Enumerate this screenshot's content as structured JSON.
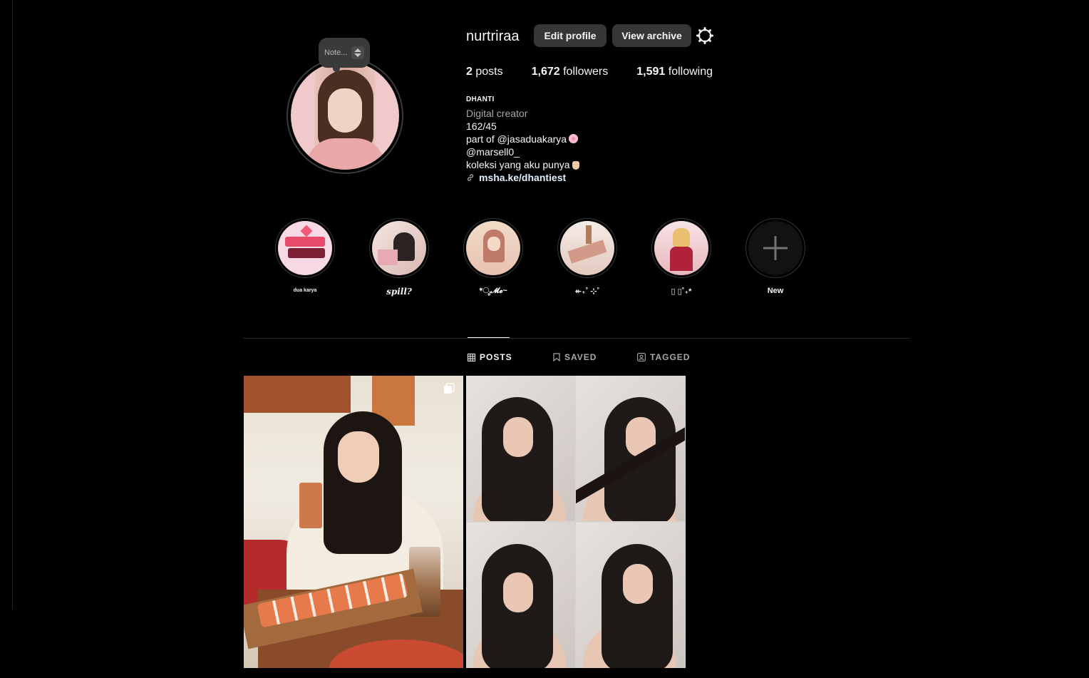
{
  "profile": {
    "username": "nurtriraa",
    "edit_label": "Edit profile",
    "archive_label": "View archive",
    "note_label": "Note...",
    "stats": {
      "posts_count": "2",
      "posts_label": "posts",
      "followers_count": "1,672",
      "followers_label": "followers",
      "following_count": "1,591",
      "following_label": "following"
    },
    "bio": {
      "name": "DHANTI",
      "category": "Digital creator",
      "line1": "162/45",
      "line2": "part of @jasaduakarya",
      "line3": "@marsell0_",
      "line4": "koleksi yang aku punya",
      "link": "msha.ke/dhantiest"
    }
  },
  "highlights": [
    {
      "label": "dua karya"
    },
    {
      "label": "spill?"
    },
    {
      "label": "*ೃ𝓜𝓮~"
    },
    {
      "label": "↞₊˚ ⊹˚"
    },
    {
      "label": "▯ ▯˚₊*"
    },
    {
      "label": "New"
    }
  ],
  "tabs": [
    {
      "label": "POSTS",
      "icon": "grid-icon",
      "active": true
    },
    {
      "label": "SAVED",
      "icon": "bookmark-icon",
      "active": false
    },
    {
      "label": "TAGGED",
      "icon": "tag-icon",
      "active": false
    }
  ],
  "posts": [
    {
      "type": "photo",
      "name": "post-1"
    },
    {
      "type": "collage",
      "name": "post-2"
    }
  ]
}
